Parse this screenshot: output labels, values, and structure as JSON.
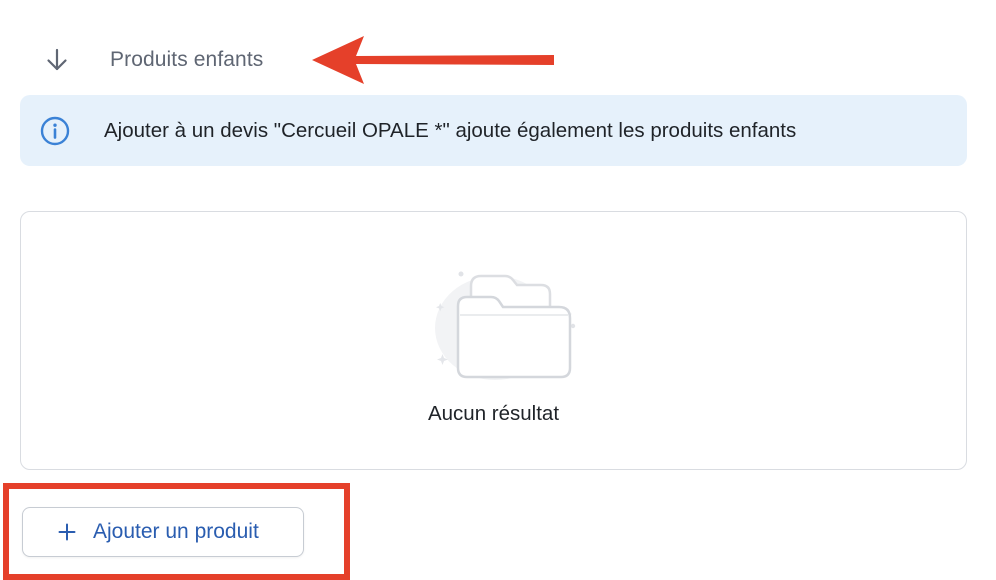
{
  "section": {
    "title": "Produits enfants",
    "toggle_icon": "arrow-down-icon"
  },
  "info_banner": {
    "icon": "info-circle-icon",
    "message": "Ajouter à un devis \"Cercueil OPALE *\" ajoute également les produits enfants"
  },
  "results": {
    "empty_icon": "empty-folder-icon",
    "empty_message": "Aucun résultat"
  },
  "actions": {
    "add_product_icon": "plus-icon",
    "add_product_label": "Ajouter un produit"
  },
  "colors": {
    "annotation_red": "#e5402a",
    "banner_bg": "#e6f1fb",
    "info_icon_blue": "#3b82d6",
    "button_text_blue": "#2a5db0"
  }
}
